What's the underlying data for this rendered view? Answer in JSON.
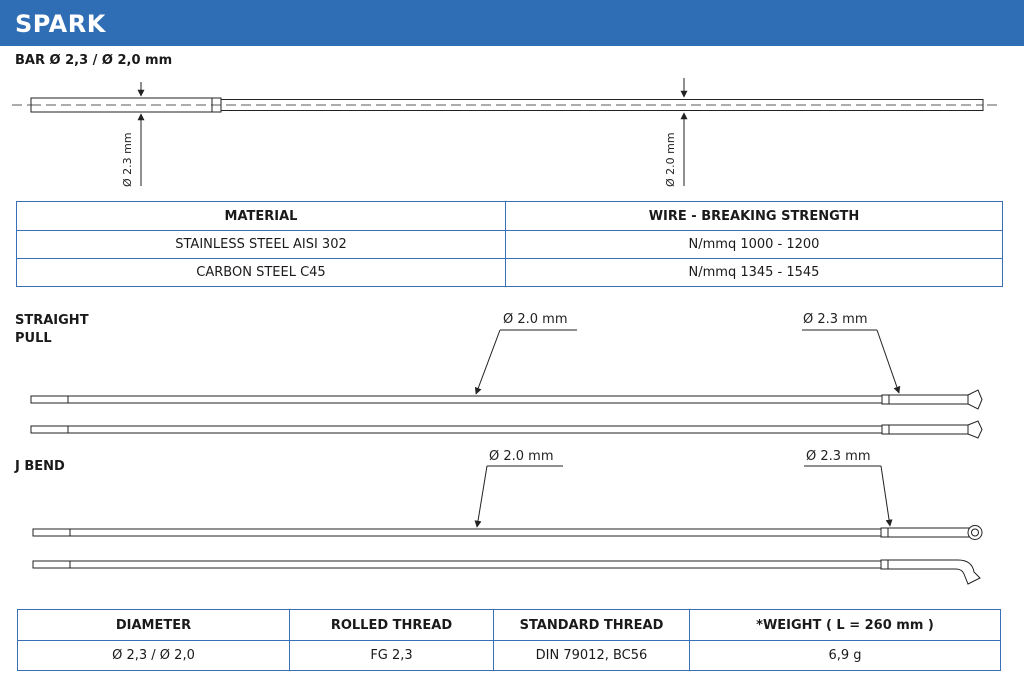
{
  "header": {
    "title": "SPARK"
  },
  "bar_section": {
    "label": "BAR Ø 2,3 / Ø 2,0 mm",
    "dim_left": "Ø 2.3 mm",
    "dim_right": "Ø 2.0 mm"
  },
  "material_table": {
    "headers": [
      "MATERIAL",
      "WIRE - BREAKING STRENGTH"
    ],
    "rows": [
      [
        "STAINLESS STEEL AISI 302",
        "N/mmq 1000 - 1200"
      ],
      [
        "CARBON STEEL C45",
        "N/mmq 1345 - 1545"
      ]
    ]
  },
  "straight_pull": {
    "label_line1": "STRAIGHT",
    "label_line2": "PULL",
    "dim_thin": "Ø 2.0 mm",
    "dim_thick": "Ø 2.3 mm"
  },
  "j_bend": {
    "label": "J BEND",
    "dim_thin": "Ø 2.0 mm",
    "dim_thick": "Ø 2.3 mm"
  },
  "dims_table": {
    "headers": [
      "DIAMETER",
      "ROLLED THREAD",
      "STANDARD THREAD",
      "*WEIGHT ( L = 260 mm )"
    ],
    "row": [
      "Ø 2,3 / Ø 2,0",
      "FG 2,3",
      "DIN 79012, BC56",
      "6,9 g"
    ]
  }
}
